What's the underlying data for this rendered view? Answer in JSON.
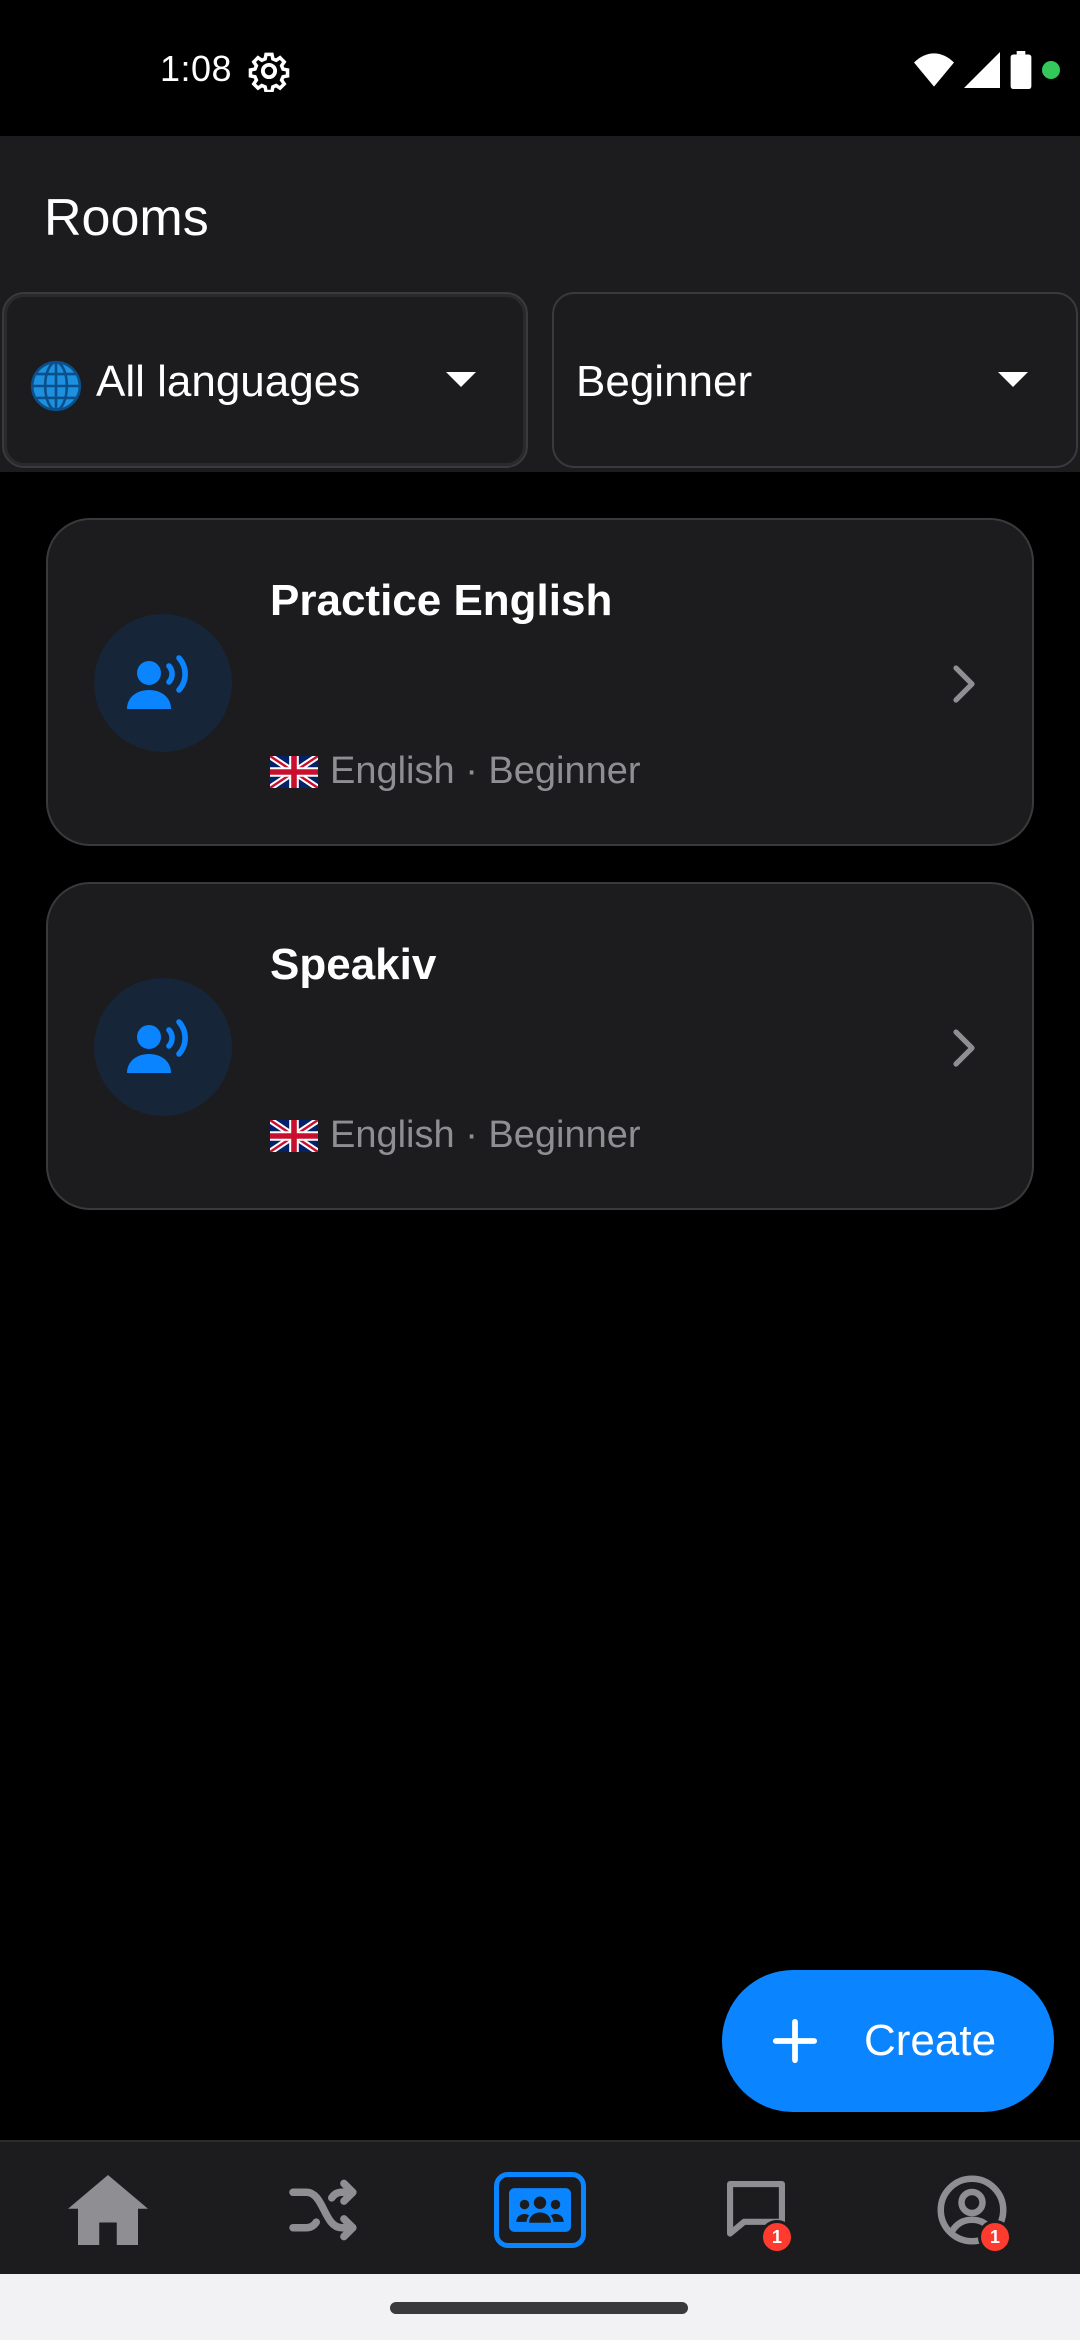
{
  "status_bar": {
    "time": "1:08",
    "icons": [
      "gear-icon",
      "wifi-icon",
      "signal-icon",
      "battery-icon",
      "privacy-dot-icon"
    ],
    "privacy_dot_color": "#34c759"
  },
  "header": {
    "title": "Rooms",
    "language_filter": {
      "icon": "globe-icon",
      "label": "All languages"
    },
    "level_filter": {
      "label": "Beginner"
    }
  },
  "rooms": [
    {
      "title": "Practice English",
      "flag": "uk-flag-icon",
      "meta": "English · Beginner"
    },
    {
      "title": "Speakiv",
      "flag": "uk-flag-icon",
      "meta": "English · Beginner"
    }
  ],
  "fab": {
    "label": "Create",
    "icon": "plus-icon"
  },
  "bottom_nav": {
    "items": [
      {
        "icon": "home-icon",
        "active": false
      },
      {
        "icon": "shuffle-icon",
        "active": false
      },
      {
        "icon": "rooms-icon",
        "active": true
      },
      {
        "icon": "chat-icon",
        "active": false,
        "badge": "1"
      },
      {
        "icon": "profile-icon",
        "active": false,
        "badge": "1"
      }
    ]
  },
  "colors": {
    "accent": "#0a84ff",
    "background": "#000000",
    "surface": "#1c1c1e",
    "secondary_text": "#8e8e93",
    "badge": "#ff3b30"
  }
}
